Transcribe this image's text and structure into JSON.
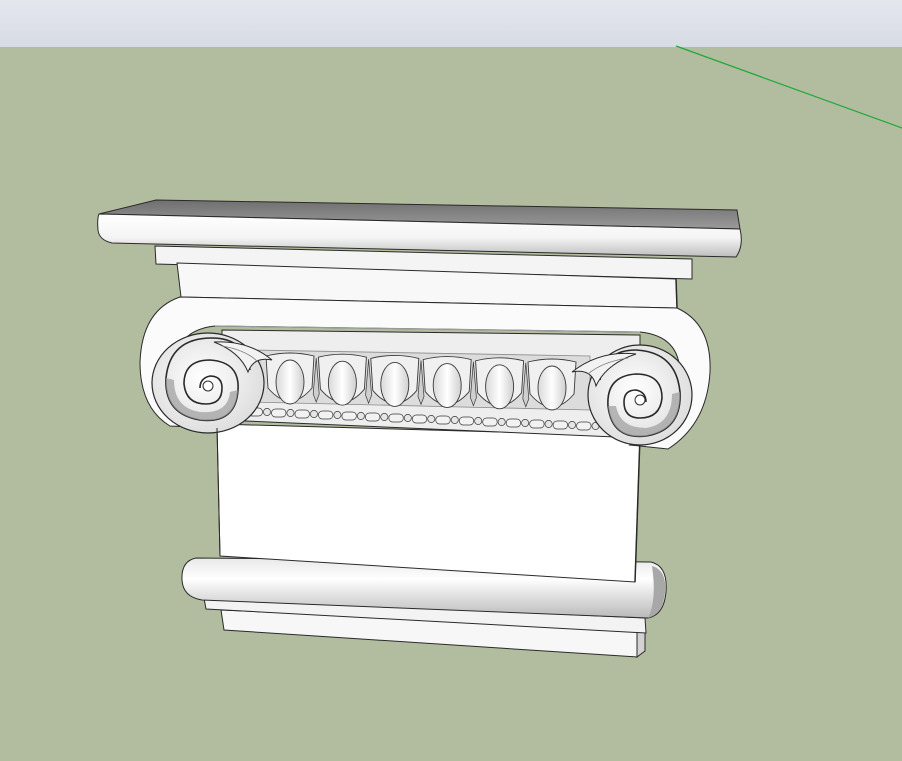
{
  "viewport": {
    "sky_color": "#dadee7",
    "ground_color": "#b1bd9e",
    "axis_color": "#1fa83c"
  },
  "model": {
    "name": "ionic-capital-component",
    "surface_color": "#ffffff",
    "shade_color": "#8c8c8c",
    "edge_color": "#2a2a2a",
    "volute_count": 2,
    "egg_count": 6
  }
}
